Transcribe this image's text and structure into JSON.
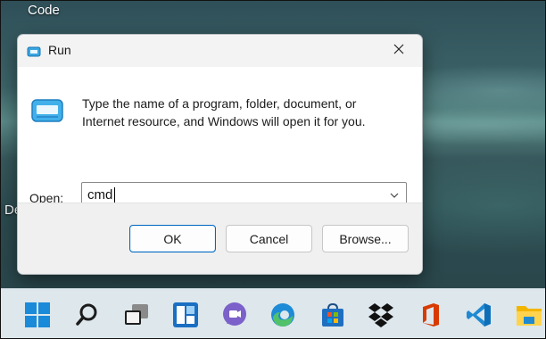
{
  "desktop": {
    "labels": [
      "Code",
      "De"
    ]
  },
  "dialog": {
    "title": "Run",
    "description_line1": "Type the name of a program, folder, document, or",
    "description_line2": "Internet resource, and Windows will open it for you.",
    "open_label": "Open:",
    "open_value": "cmd",
    "buttons": {
      "ok": "OK",
      "cancel": "Cancel",
      "browse": "Browse..."
    }
  },
  "taskbar": {
    "icons": [
      "start-icon",
      "search-icon",
      "task-view-icon",
      "widgets-icon",
      "teams-chat-icon",
      "edge-icon",
      "microsoft-store-icon",
      "dropbox-icon",
      "office-icon",
      "vscode-icon",
      "file-explorer-icon"
    ]
  },
  "colors": {
    "accent": "#0067c0",
    "taskbar_bg": "#dde7ec",
    "dialog_bg": "#f3f3f3"
  }
}
